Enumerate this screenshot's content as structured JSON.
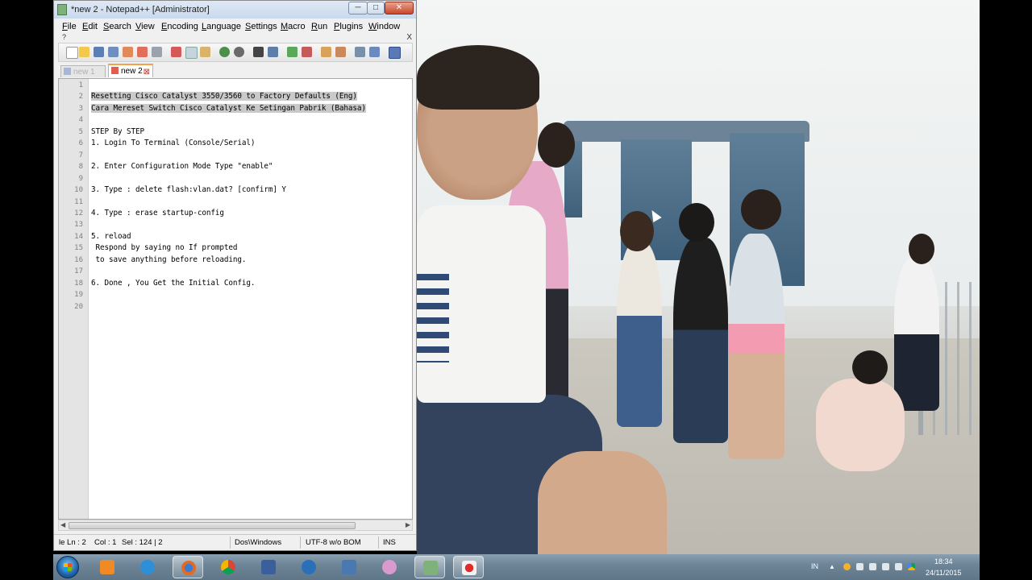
{
  "window": {
    "title": "*new 2 - Notepad++ [Administrator]",
    "controls": {
      "minimize": "─",
      "maximize": "□",
      "close": "✕"
    }
  },
  "menu": {
    "items": [
      "File",
      "Edit",
      "Search",
      "View",
      "Encoding",
      "Language",
      "Settings",
      "Macro",
      "Run",
      "Plugins",
      "Window"
    ],
    "overflow_help": "?",
    "close_doc": "X"
  },
  "toolbar": {
    "icons": [
      "new-file",
      "open-file",
      "save",
      "save-all",
      "close",
      "close-all",
      "print",
      "cut",
      "copy",
      "paste",
      "undo",
      "redo",
      "find",
      "replace",
      "zoom-in",
      "zoom-out",
      "sync-v",
      "sync-h",
      "word-wrap",
      "show-all",
      "indent-guide"
    ]
  },
  "tabs": [
    {
      "label": "new  1",
      "active": false
    },
    {
      "label": "new  2",
      "active": true
    }
  ],
  "editor": {
    "lines": [
      {
        "n": "1",
        "text": ""
      },
      {
        "n": "2",
        "text": "Resetting Cisco Catalyst 3550/3560 to Factory Defaults (Eng)",
        "selected": true
      },
      {
        "n": "3",
        "text": "Cara Mereset Switch Cisco Catalyst Ke Setingan Pabrik (Bahasa)",
        "selected": true
      },
      {
        "n": "4",
        "text": ""
      },
      {
        "n": "5",
        "text": "STEP By STEP"
      },
      {
        "n": "6",
        "text": "1. Login To Terminal (Console/Serial)"
      },
      {
        "n": "7",
        "text": ""
      },
      {
        "n": "8",
        "text": "2. Enter Configuration Mode Type \"enable\""
      },
      {
        "n": "9",
        "text": ""
      },
      {
        "n": "10",
        "text": "3. Type : delete flash:vlan.dat? [confirm] Y"
      },
      {
        "n": "11",
        "text": ""
      },
      {
        "n": "12",
        "text": "4. Type : erase startup-config"
      },
      {
        "n": "13",
        "text": ""
      },
      {
        "n": "14",
        "text": "5. reload"
      },
      {
        "n": "15",
        "text": " Respond by saying no If prompted"
      },
      {
        "n": "16",
        "text": " to save anything before reloading."
      },
      {
        "n": "17",
        "text": ""
      },
      {
        "n": "18",
        "text": "6. Done , You Get the Initial Config."
      },
      {
        "n": "19",
        "text": ""
      },
      {
        "n": "20",
        "text": ""
      }
    ]
  },
  "status": {
    "ln": "le Ln : 2",
    "col": "Col : 1",
    "sel": "Sel : 124 | 2",
    "eol": "Dos\\Windows",
    "encoding": "UTF-8 w/o BOM",
    "mode": "INS"
  },
  "taskbar": {
    "apps": [
      "media-player",
      "internet-explorer",
      "firefox",
      "chrome",
      "network-tool",
      "messenger",
      "utility",
      "paint-brush",
      "chart-app",
      "screen-recorder"
    ],
    "tray": {
      "lang": "IN",
      "time": "18:34",
      "date": "24/11/2015"
    }
  },
  "colors": {
    "selection": "#c9c9c9",
    "tab_accent": "#f3a24a",
    "taskbar": "#6d8597"
  }
}
